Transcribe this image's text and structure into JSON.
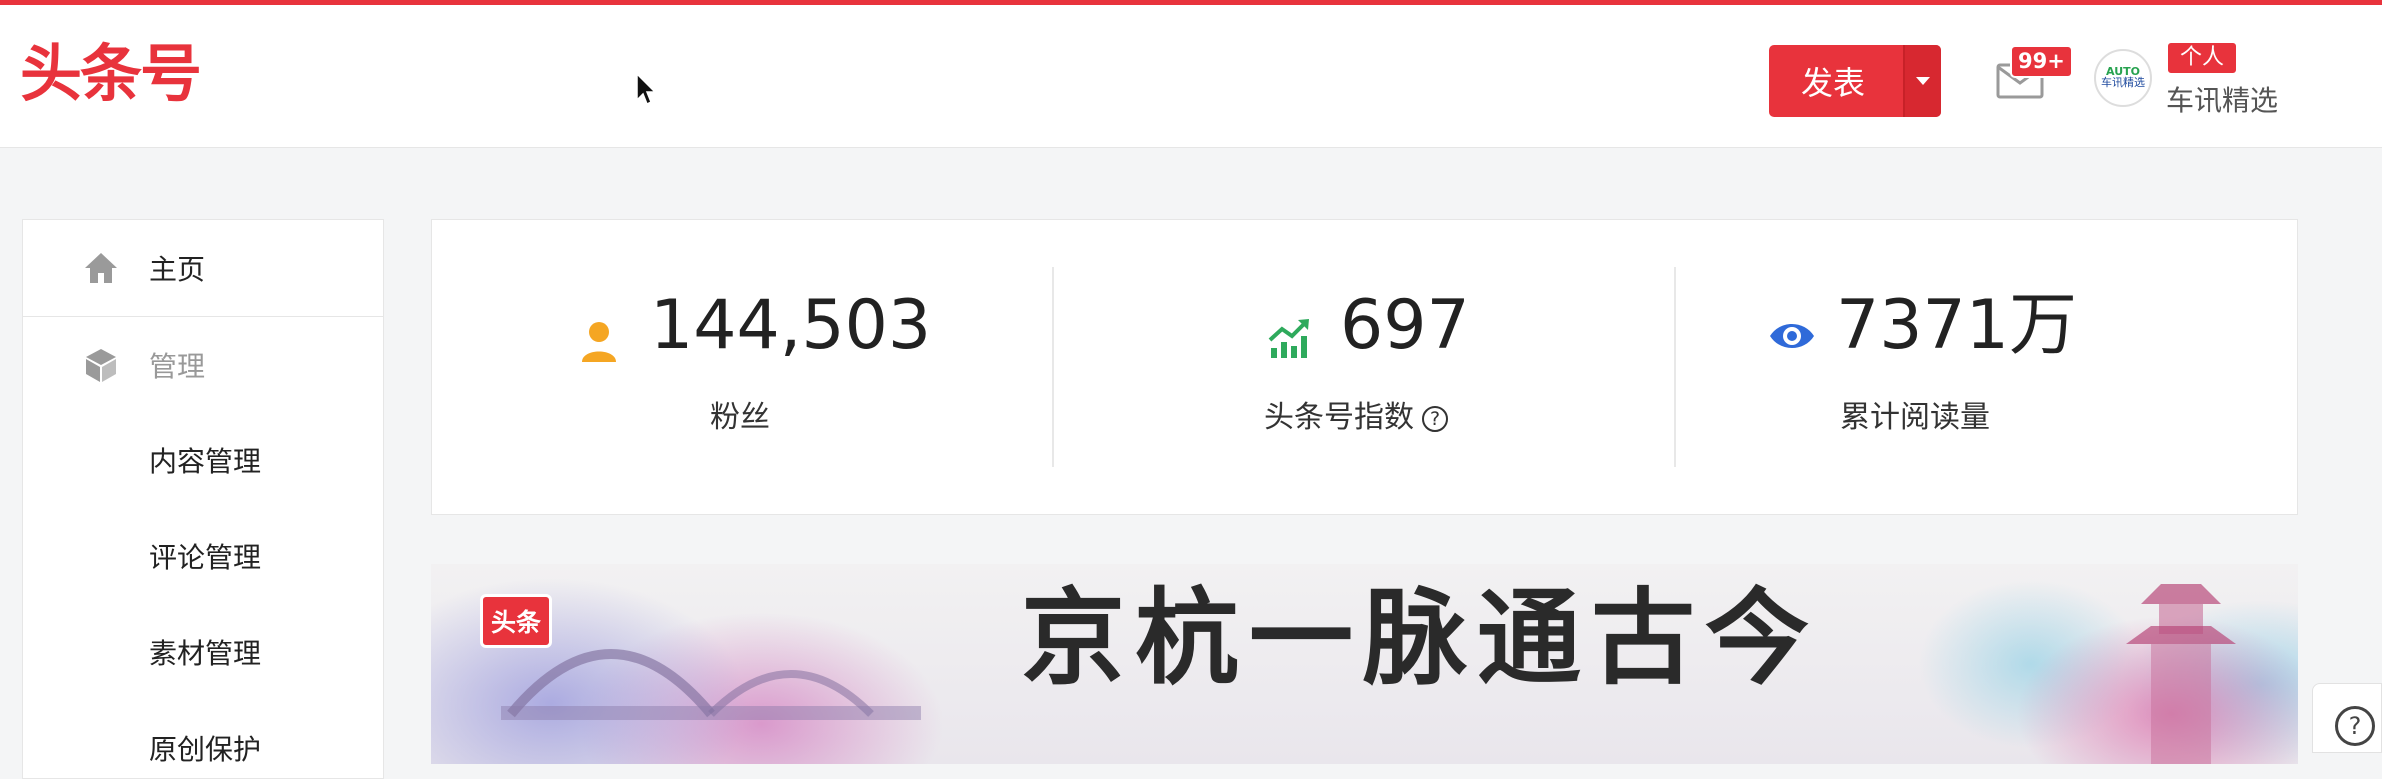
{
  "header": {
    "logo": "头条号",
    "publish_label": "发表",
    "mail_badge": "99+",
    "avatar_line1": "AUTO",
    "avatar_line2": "车讯精选",
    "role_badge": "个人",
    "account_name": "车讯精选"
  },
  "sidebar": {
    "home_label": "主页",
    "manage_label": "管理",
    "sub_items": [
      "内容管理",
      "评论管理",
      "素材管理",
      "原创保护"
    ]
  },
  "stats": [
    {
      "value": "144,503",
      "label": "粉丝",
      "icon": "user-icon",
      "color": "#f5a623"
    },
    {
      "value": "697",
      "label": "头条号指数",
      "icon": "trend-up-icon",
      "color": "#2eaa5c"
    },
    {
      "value": "7371万",
      "label": "累计阅读量",
      "icon": "eye-icon",
      "color": "#2f6ad9"
    }
  ],
  "help_glyph": "?",
  "banner": {
    "badge": "头条",
    "title": "京杭一脉通古今"
  },
  "colors": {
    "brand": "#e8333c"
  }
}
